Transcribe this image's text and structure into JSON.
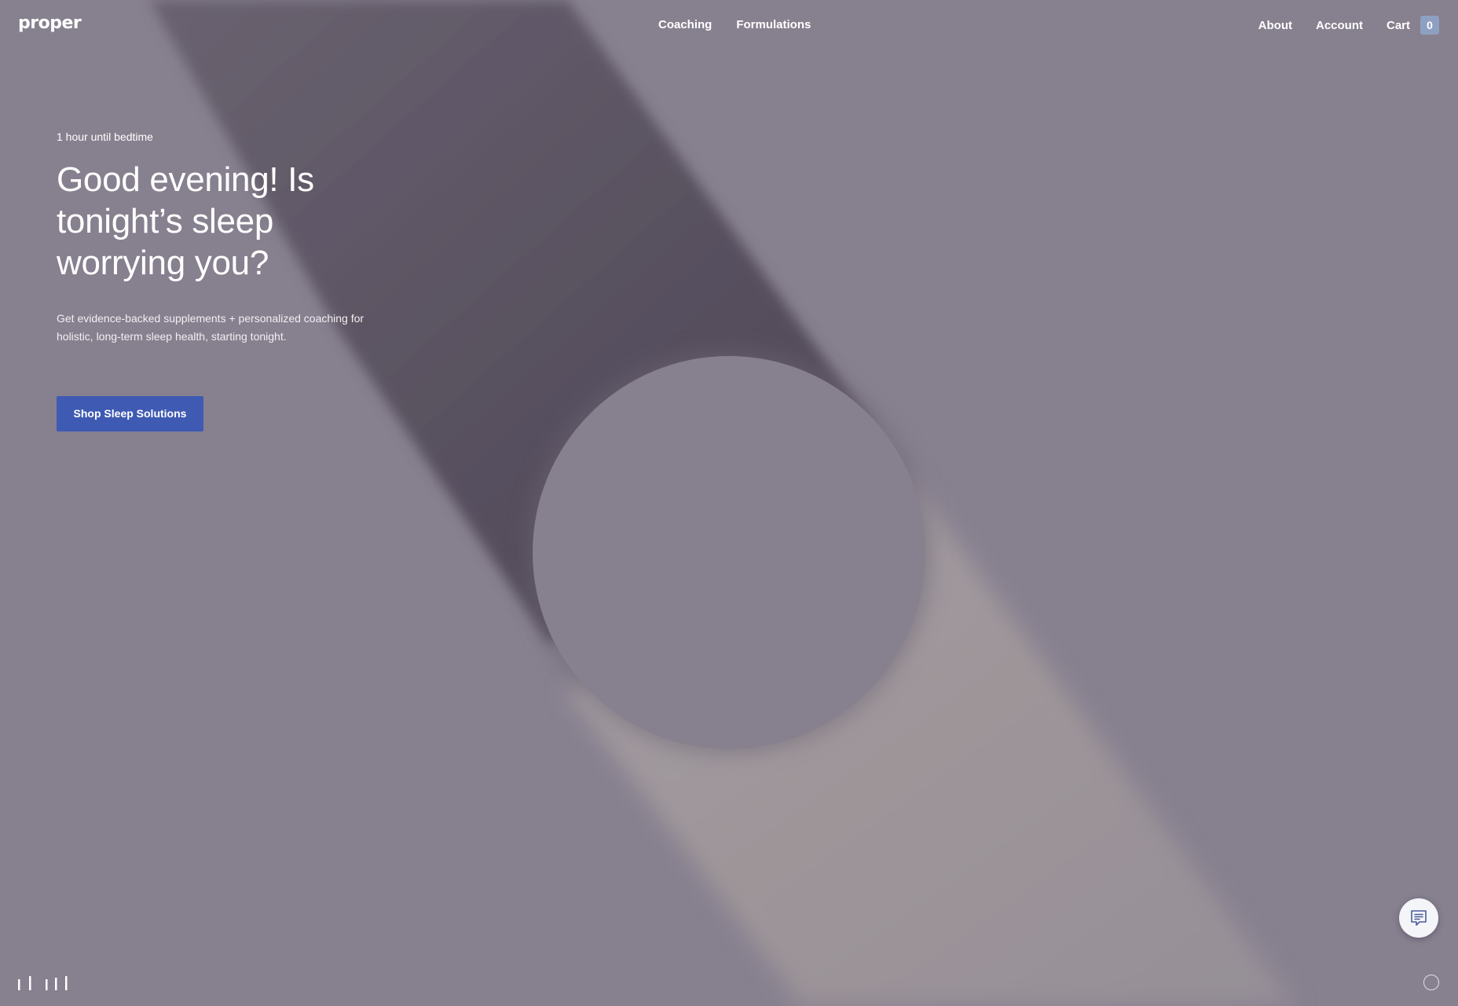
{
  "header": {
    "logo": "proper",
    "nav_center": [
      "Coaching",
      "Formulations"
    ],
    "nav_right": {
      "about": "About",
      "account": "Account",
      "cart_label": "Cart",
      "cart_count": "0"
    }
  },
  "hero": {
    "eyebrow": "1 hour until bedtime",
    "headline": "Good evening! Is tonight’s sleep worrying you?",
    "subcopy": "Get evidence-backed supplements + personalized coaching for holistic, long-term sleep health, starting tonight.",
    "cta_label": "Shop Sleep Solutions"
  },
  "icons": {
    "chat": "chat-icon",
    "sound": "sound-bars-icon",
    "circle": "circle-icon"
  },
  "colors": {
    "background": "#87808f",
    "cta": "#3f5ab2",
    "cart_badge": "#8ea0c2"
  }
}
